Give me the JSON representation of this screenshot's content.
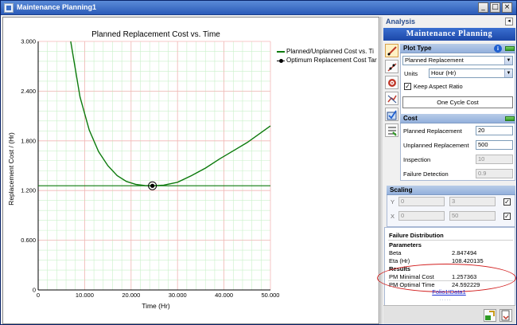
{
  "window": {
    "title": "Maintenance Planning1",
    "buttons": {
      "minimize": "_",
      "maximize": "□",
      "close": "×"
    }
  },
  "chart_data": {
    "type": "line",
    "title": "Planned Replacement Cost vs. Time",
    "xlabel": "Time (Hr)",
    "ylabel": "Replacement Cost / (Hr)",
    "xlim": [
      0,
      50000
    ],
    "ylim": [
      0,
      3
    ],
    "x_ticks": [
      "0",
      "10.000",
      "20.000",
      "30.000",
      "40.000",
      "50.000"
    ],
    "y_ticks": [
      "0",
      "0.600",
      "1.200",
      "1.800",
      "2.400",
      "3.000"
    ],
    "grid": true,
    "legend_position": "top-right",
    "series": [
      {
        "name": "Planned/Unplanned Cost vs. Ti",
        "color": "#0c7a0c",
        "points": [
          [
            7000,
            3.0
          ],
          [
            9000,
            2.33
          ],
          [
            11000,
            1.93
          ],
          [
            13000,
            1.67
          ],
          [
            15000,
            1.5
          ],
          [
            17000,
            1.38
          ],
          [
            19000,
            1.31
          ],
          [
            21000,
            1.275
          ],
          [
            23000,
            1.26
          ],
          [
            24592,
            1.257363
          ],
          [
            27000,
            1.265
          ],
          [
            30000,
            1.3
          ],
          [
            33000,
            1.38
          ],
          [
            36000,
            1.47
          ],
          [
            39000,
            1.58
          ],
          [
            42000,
            1.68
          ],
          [
            45000,
            1.78
          ],
          [
            48000,
            1.9
          ],
          [
            50000,
            1.98
          ]
        ]
      },
      {
        "name": "Optimum Replacement Cost Tar",
        "color": "#0c7a0c",
        "kind": "target",
        "target": [
          24592.229,
          1.257363
        ]
      }
    ]
  },
  "panel": {
    "header": "Analysis",
    "pin": "◂",
    "banner": "Maintenance Planning",
    "plot_type": {
      "title": "Plot Type",
      "info": "i",
      "selected": "Planned Replacement",
      "units_label": "Units",
      "units_value": "Hour (Hr)",
      "keep_aspect_label": "Keep Aspect Ratio",
      "keep_aspect_checked": "✓",
      "cost_button": "One Cycle Cost"
    },
    "cost": {
      "title": "Cost",
      "fields": [
        {
          "label": "Planned Replacement",
          "value": "20",
          "enabled": true
        },
        {
          "label": "Unplanned Replacement",
          "value": "500",
          "enabled": true
        },
        {
          "label": "Inspection",
          "value": "10",
          "enabled": false
        },
        {
          "label": "Failure Detection",
          "value": "0.9",
          "enabled": false
        }
      ]
    },
    "scaling": {
      "title": "Scaling",
      "y_label": "Y",
      "y_min": "0",
      "y_max": "3",
      "x_label": "X",
      "x_min": "0",
      "x_max": "50",
      "y_checked": "✓",
      "x_checked": "✓"
    },
    "results": {
      "distribution_title": "Failure Distribution",
      "parameters_title": "Parameters",
      "params": [
        {
          "label": "Beta",
          "value": "2.847494"
        },
        {
          "label": "Eta (Hr)",
          "value": "108.420135"
        }
      ],
      "results_title": "Results",
      "results": [
        {
          "label": "PM Minimal Cost",
          "value": "1.257363"
        },
        {
          "label": "PM Optimal Time",
          "value": "24.592229"
        }
      ],
      "folio_link": "Folio1!Data1",
      "grip": "....."
    },
    "icons": [
      "line-plot-icon",
      "scatter-plot-icon",
      "target-icon",
      "trend-icon",
      "check-chart-icon",
      "list-icon",
      "transfer-icon",
      "export-icon"
    ]
  }
}
